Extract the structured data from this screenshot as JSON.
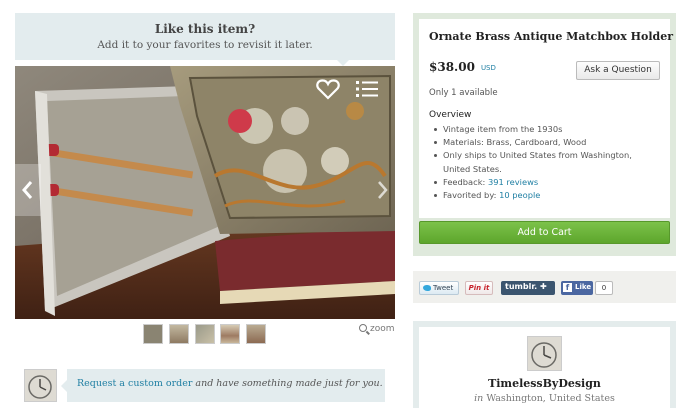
{
  "favorite_prompt": {
    "title": "Like this item?",
    "subtitle": "Add it to your favorites to revisit it later."
  },
  "photo": {
    "icons": [
      "heart-icon",
      "list-icon",
      "chevron-left-icon",
      "chevron-right-icon"
    ]
  },
  "thumbnails": {
    "count": 5
  },
  "zoom_label": "zoom",
  "custom_order": {
    "link_text": "Request a custom order",
    "rest_text": " and have something made just for you."
  },
  "listing": {
    "title": "Ornate Brass Antique Matchbox Holder",
    "price": "$38.00",
    "currency": "USD",
    "ask_button": "Ask a Question",
    "availability": "Only 1 available",
    "overview_label": "Overview",
    "overview": [
      "Vintage item from the 1930s",
      "Materials: Brass, Cardboard, Wood",
      "Only ships to United States from Washington, United States."
    ],
    "feedback_label": "Feedback: ",
    "feedback_link": "391 reviews",
    "favorited_label": "Favorited by: ",
    "favorited_link": "10 people",
    "add_to_cart": "Add to Cart"
  },
  "share": {
    "tweet": "Tweet",
    "pinit": "Pin it",
    "tumblr": "tumblr. ✚",
    "fb_like": "Like",
    "fb_count": "0"
  },
  "shop": {
    "name": "TimelessByDesign",
    "location_prefix": "in",
    "location": " Washington, United States"
  },
  "colors": {
    "accent_link": "#1f7fa3",
    "cart_green": "#6ab43a",
    "prompt_bg": "#e3ecee"
  }
}
